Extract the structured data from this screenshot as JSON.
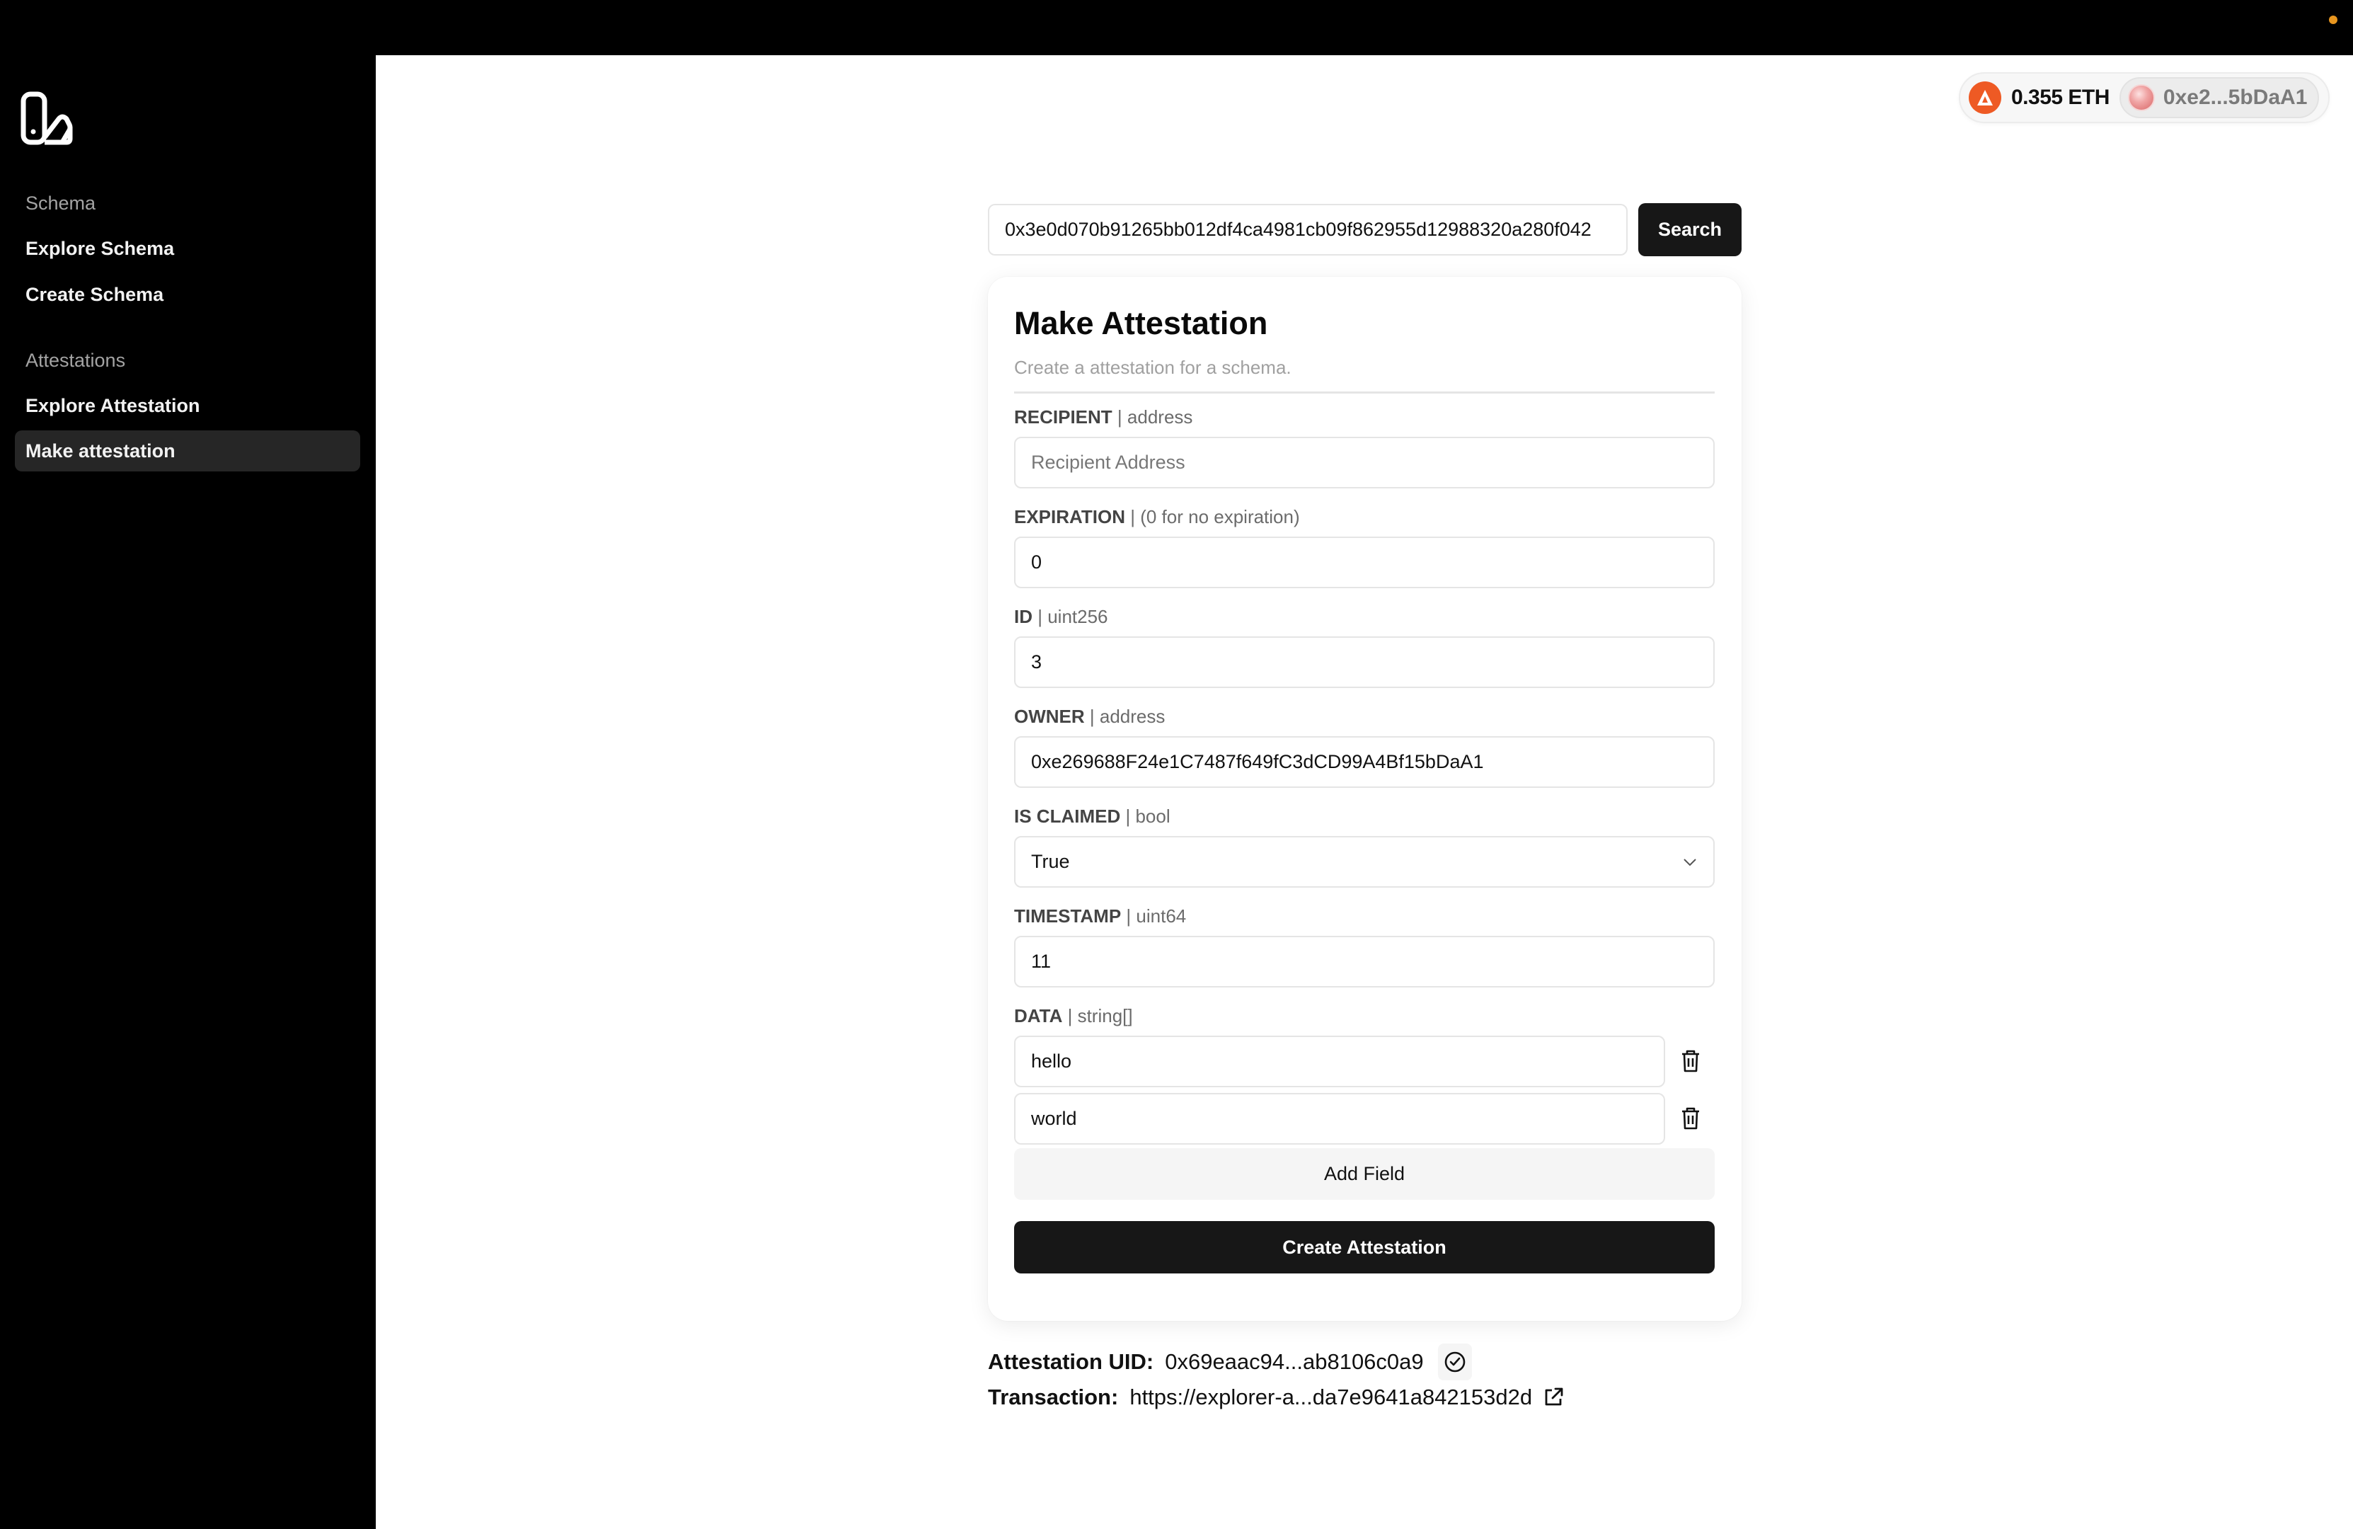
{
  "sidebar": {
    "logo": "app-logo",
    "sections": [
      {
        "title": "Schema",
        "items": [
          {
            "label": "Explore Schema"
          },
          {
            "label": "Create Schema"
          }
        ]
      },
      {
        "title": "Attestations",
        "items": [
          {
            "label": "Explore Attestation"
          },
          {
            "label": "Make attestation",
            "active": true
          }
        ]
      }
    ]
  },
  "wallet": {
    "chain_icon": "arbitrum-style-chain-icon",
    "balance": "0.355 ETH",
    "address": "0xe2...5bDaA1"
  },
  "search": {
    "value": "0x3e0d070b91265bb012df4ca4981cb09f862955d12988320a280f042",
    "button_label": "Search"
  },
  "card": {
    "title": "Make Attestation",
    "subtitle": "Create a attestation for a schema.",
    "fields": {
      "recipient": {
        "label": "RECIPIENT",
        "type": "| address",
        "placeholder": "Recipient Address",
        "value": ""
      },
      "expiration": {
        "label": "EXPIRATION",
        "type": "| (0 for no expiration)",
        "value": "0"
      },
      "id": {
        "label": "ID",
        "type": "| uint256",
        "value": "3"
      },
      "owner": {
        "label": "OWNER",
        "type": "| address",
        "value": "0xe269688F24e1C7487f649fC3dCD99A4Bf15bDaA1"
      },
      "is_claimed": {
        "label": "IS CLAIMED",
        "type": "| bool",
        "value": "True"
      },
      "timestamp": {
        "label": "TIMESTAMP",
        "type": "| uint64",
        "value": "11"
      },
      "data": {
        "label": "DATA",
        "type": "| string[]",
        "values": [
          "hello",
          "world"
        ]
      }
    },
    "add_field_label": "Add Field",
    "create_label": "Create Attestation"
  },
  "result": {
    "uid_label": "Attestation UID:",
    "uid_value": "0x69eaac94...ab8106c0a9",
    "tx_label": "Transaction:",
    "tx_value": "https://explorer-a...da7e9641a842153d2d"
  },
  "colors": {
    "accent_chain": "#ee5a24",
    "primary_button": "#171717",
    "status_dot": "#e8961f"
  }
}
